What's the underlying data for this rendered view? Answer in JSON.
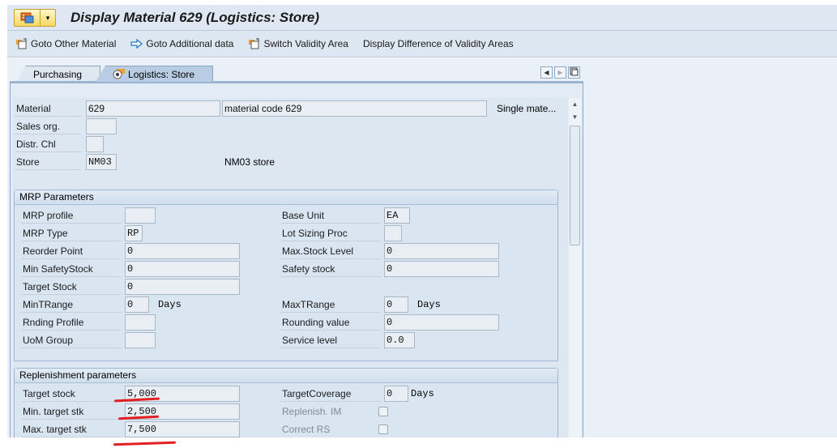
{
  "window": {
    "title": "Display Material 629 (Logistics: Store)"
  },
  "toolbar": {
    "items": [
      {
        "label": "Goto Other Material",
        "icon": "new-window-icon"
      },
      {
        "label": "Goto Additional data",
        "icon": "arrow-right-icon"
      },
      {
        "label": "Switch Validity Area",
        "icon": "new-window-icon"
      },
      {
        "label": "Display Difference of Validity Areas",
        "icon": ""
      }
    ]
  },
  "tabs": [
    {
      "label": "Purchasing",
      "active": false
    },
    {
      "label": "Logistics: Store",
      "active": true
    }
  ],
  "header_fields": {
    "material": {
      "label": "Material",
      "value": "629",
      "description": "material code 629",
      "type_text": "Single mate..."
    },
    "sales_org": {
      "label": "Sales org.",
      "value": ""
    },
    "distr_chl": {
      "label": "Distr. Chl",
      "value": ""
    },
    "store": {
      "label": "Store",
      "value": "NM03",
      "description": "NM03 store"
    }
  },
  "mrp": {
    "title": "MRP Parameters",
    "mrp_profile": {
      "label": "MRP profile",
      "value": ""
    },
    "mrp_type": {
      "label": "MRP Type",
      "value": "RP"
    },
    "reorder_point": {
      "label": "Reorder Point",
      "value": "0"
    },
    "min_safety_stock": {
      "label": "Min SafetyStock",
      "value": "0"
    },
    "target_stock": {
      "label": "Target Stock",
      "value": "0"
    },
    "min_t_range": {
      "label": "MinTRange",
      "value": "0",
      "unit": "Days"
    },
    "rnding_profile": {
      "label": "Rnding Profile",
      "value": ""
    },
    "uom_group": {
      "label": "UoM Group",
      "value": ""
    },
    "base_unit": {
      "label": "Base Unit",
      "value": "EA"
    },
    "lot_sizing": {
      "label": "Lot Sizing Proc",
      "value": ""
    },
    "max_stock_level": {
      "label": "Max.Stock Level",
      "value": "0"
    },
    "safety_stock": {
      "label": "Safety stock",
      "value": "0"
    },
    "max_t_range": {
      "label": "MaxTRange",
      "value": "0",
      "unit": "Days"
    },
    "rounding_value": {
      "label": "Rounding value",
      "value": "0"
    },
    "service_level": {
      "label": "Service level",
      "value": "0.0"
    }
  },
  "replenishment": {
    "title": "Replenishment parameters",
    "target_stock": {
      "label": "Target stock",
      "value": "5,000"
    },
    "min_target_stk": {
      "label": "Min. target stk",
      "value": "2,500"
    },
    "max_target_stk": {
      "label": "Max. target stk",
      "value": "7,500"
    },
    "target_coverage": {
      "label": "TargetCoverage",
      "value": "0",
      "unit": "Days"
    },
    "replenish_im": {
      "label": "Replenish. IM",
      "checked": false
    },
    "correct_rs": {
      "label": "Correct RS",
      "checked": false
    }
  }
}
